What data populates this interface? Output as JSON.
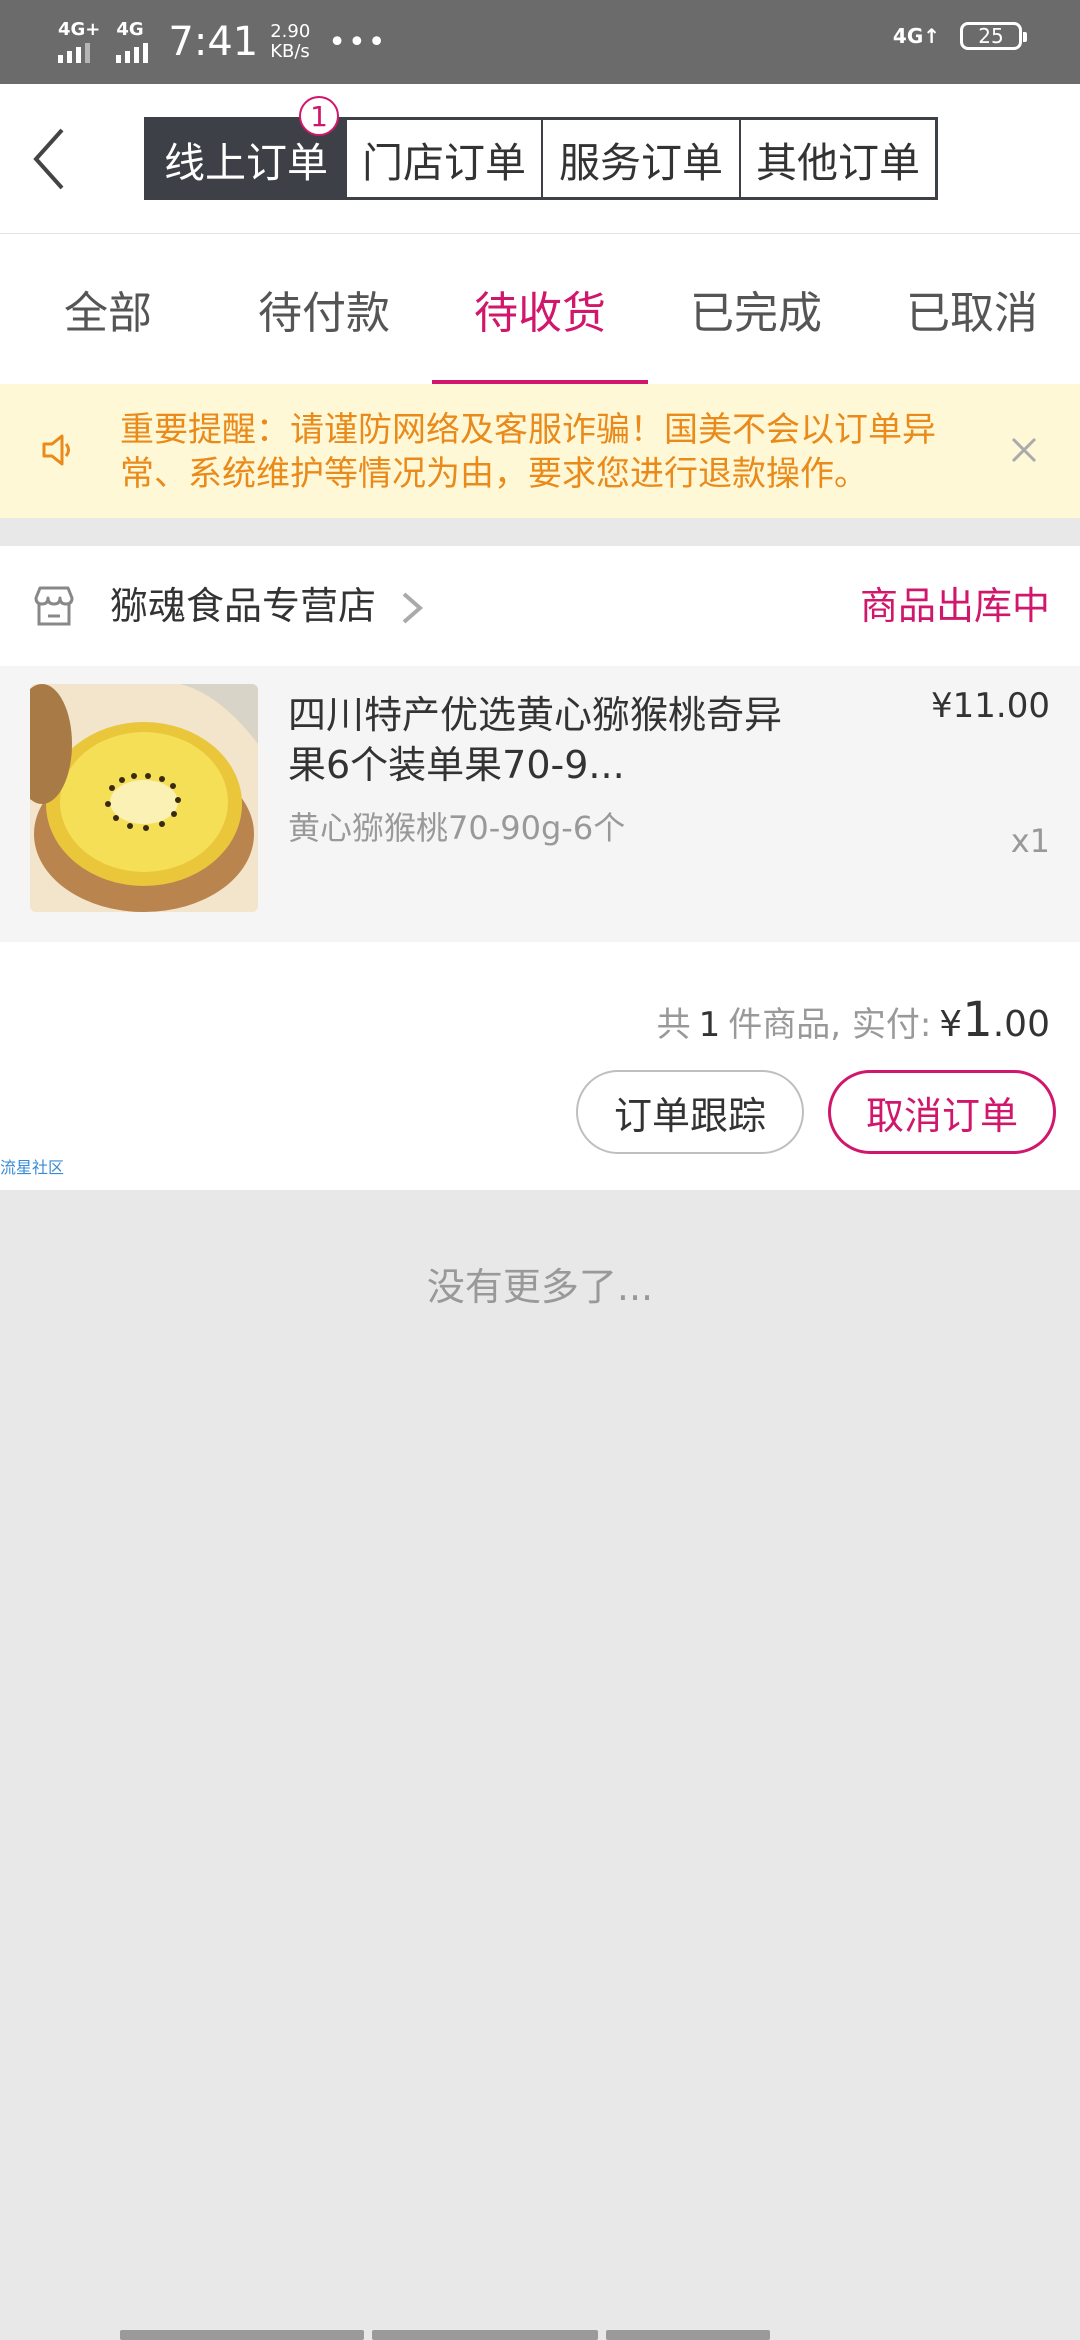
{
  "status_bar": {
    "signal1": "4G+",
    "signal2": "4G",
    "time": "7:41",
    "speed_value": "2.90",
    "speed_unit": "KB/s",
    "more": "•••",
    "network_right": "4G↑",
    "battery": "25"
  },
  "header": {
    "segments": [
      "线上订单",
      "门店订单",
      "服务订单",
      "其他订单"
    ],
    "active_segment": 0,
    "badge": "1"
  },
  "tabs": {
    "items": [
      "全部",
      "待付款",
      "待收货",
      "已完成",
      "已取消"
    ],
    "active": 2
  },
  "notice": {
    "text": "重要提醒：请谨防网络及客服诈骗！国美不会以订单异常、系统维护等情况为由，要求您进行退款操作。"
  },
  "order": {
    "store_name": "猕魂食品专营店",
    "status": "商品出库中",
    "item": {
      "title": "四川特产优选黄心猕猴桃奇异果6个装单果70-9...",
      "spec": "黄心猕猴桃70-90g-6个",
      "price": "¥11.00",
      "qty": "x1"
    },
    "summary": {
      "prefix": "共",
      "count": "1",
      "suffix": "件商品, 实付:",
      "currency": "¥",
      "amount_int": "1",
      "amount_dec": ".00"
    },
    "buttons": {
      "track": "订单跟踪",
      "cancel": "取消订单"
    },
    "watermark": "流星社区"
  },
  "footer": {
    "no_more": "没有更多了..."
  },
  "colors": {
    "accent": "#d1176b",
    "notice_bg": "#fff8d6",
    "notice_text": "#e98a1a",
    "segment_active_bg": "#3d4147"
  }
}
